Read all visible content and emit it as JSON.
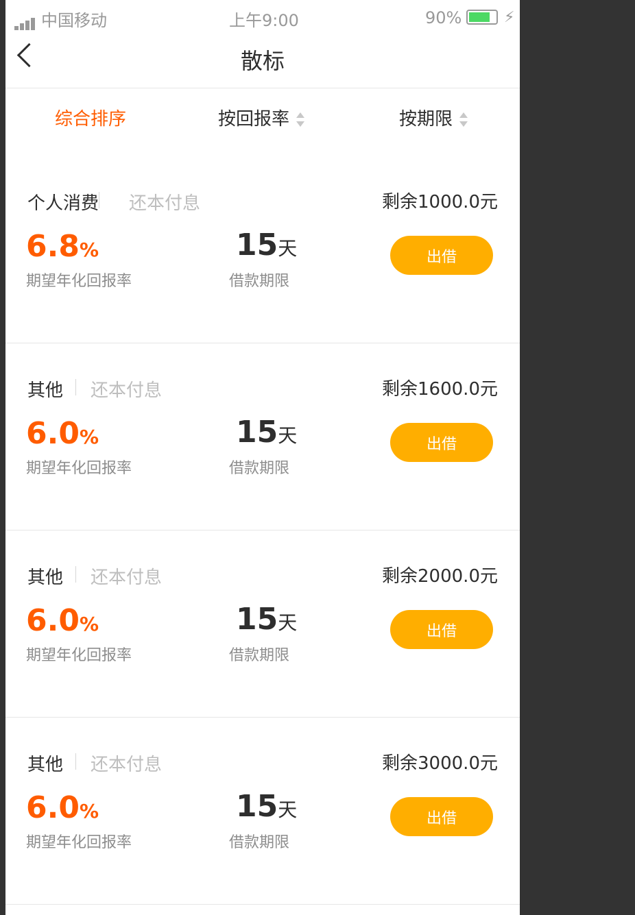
{
  "status_bar": {
    "carrier": "中国移动",
    "time": "上午9:00",
    "battery_percent": "90%",
    "signal_icon": "signal-bars-icon",
    "battery_icon": "battery-icon",
    "charging_icon": "lightning-icon"
  },
  "nav": {
    "title": "散标",
    "back_icon": "chevron-left-icon"
  },
  "filters": [
    {
      "label": "综合排序",
      "active": true
    },
    {
      "label": "按回报率",
      "active": false,
      "icon": "sort-arrows-icon"
    },
    {
      "label": "按期限",
      "active": false,
      "icon": "sort-arrows-icon"
    }
  ],
  "loans": [
    {
      "category": "个人消费",
      "repayment": "还本付息",
      "remaining": "剩余1000.0元",
      "rate": "6.8",
      "rate_unit": "%",
      "rate_label": "期望年化回报率",
      "term": "15",
      "term_unit": "天",
      "term_label": "借款期限",
      "button": "出借"
    },
    {
      "category": "其他",
      "repayment": "还本付息",
      "remaining": "剩余1600.0元",
      "rate": "6.0",
      "rate_unit": "%",
      "rate_label": "期望年化回报率",
      "term": "15",
      "term_unit": "天",
      "term_label": "借款期限",
      "button": "出借"
    },
    {
      "category": "其他",
      "repayment": "还本付息",
      "remaining": "剩余2000.0元",
      "rate": "6.0",
      "rate_unit": "%",
      "rate_label": "期望年化回报率",
      "term": "15",
      "term_unit": "天",
      "term_label": "借款期限",
      "button": "出借"
    },
    {
      "category": "其他",
      "repayment": "还本付息",
      "remaining": "剩余3000.0元",
      "rate": "6.0",
      "rate_unit": "%",
      "rate_label": "期望年化回报率",
      "term": "15",
      "term_unit": "天",
      "term_label": "借款期限",
      "button": "出借"
    }
  ],
  "colors": {
    "accent": "#ff5c00",
    "button_fill": "#ffae00",
    "text_primary": "#2e2e2e",
    "text_secondary": "#8d8d8d",
    "text_muted": "#bebebe"
  }
}
